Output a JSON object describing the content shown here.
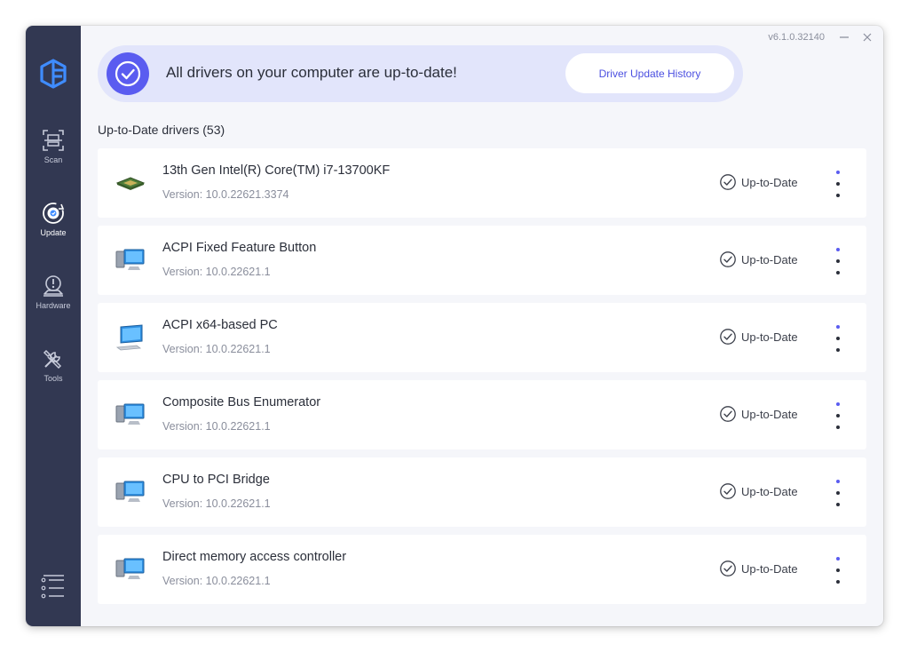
{
  "app": {
    "version": "v6.1.0.32140"
  },
  "sidebar": {
    "items": [
      {
        "label": "Scan",
        "icon": "scan-icon"
      },
      {
        "label": "Update",
        "icon": "update-icon"
      },
      {
        "label": "Hardware",
        "icon": "hardware-icon"
      },
      {
        "label": "Tools",
        "icon": "tools-icon"
      }
    ],
    "active": "Update"
  },
  "banner": {
    "message": "All drivers on your computer are up-to-date!",
    "history_button": "Driver Update History"
  },
  "section": {
    "title": "Up-to-Date drivers (53)"
  },
  "drivers": [
    {
      "name": "13th Gen Intel(R) Core(TM) i7-13700KF",
      "version": "Version: 10.0.22621.3374",
      "status": "Up-to-Date",
      "icon": "cpu-chip-icon"
    },
    {
      "name": "ACPI Fixed Feature Button",
      "version": "Version: 10.0.22621.1",
      "status": "Up-to-Date",
      "icon": "computer-system-icon"
    },
    {
      "name": "ACPI x64-based PC",
      "version": "Version: 10.0.22621.1",
      "status": "Up-to-Date",
      "icon": "monitor-icon"
    },
    {
      "name": "Composite Bus Enumerator",
      "version": "Version: 10.0.22621.1",
      "status": "Up-to-Date",
      "icon": "computer-system-icon"
    },
    {
      "name": "CPU to PCI Bridge",
      "version": "Version: 10.0.22621.1",
      "status": "Up-to-Date",
      "icon": "computer-system-icon"
    },
    {
      "name": "Direct memory access controller",
      "version": "Version: 10.0.22621.1",
      "status": "Up-to-Date",
      "icon": "computer-system-icon"
    }
  ],
  "colors": {
    "sidebar": "#323852",
    "accent": "#5a5cf0",
    "banner": "#e2e5fb"
  }
}
